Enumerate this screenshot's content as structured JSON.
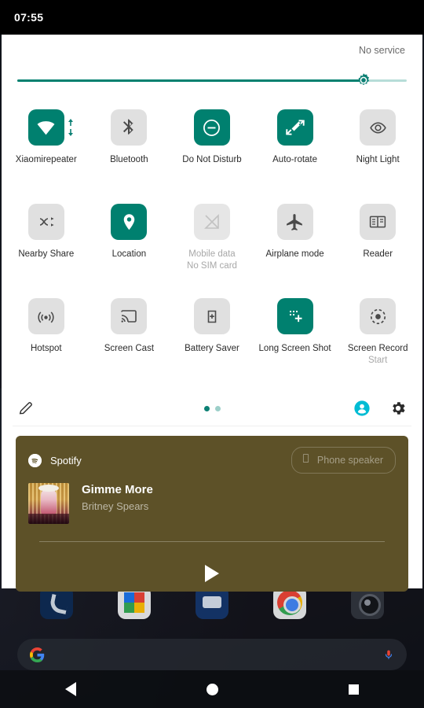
{
  "statusbar": {
    "clock": "07:55"
  },
  "panel": {
    "carrier": "No service",
    "brightness": {
      "value_percent": 89,
      "icon": "brightness-icon"
    }
  },
  "tiles": [
    [
      {
        "label": "Xiaomirepeater",
        "icon": "wifi-icon",
        "state": "on",
        "badge": "data-activity-arrows"
      },
      {
        "label": "Bluetooth",
        "icon": "bluetooth-icon",
        "state": "off"
      },
      {
        "label": "Do Not Disturb",
        "icon": "do-not-disturb-icon",
        "state": "on"
      },
      {
        "label": "Auto-rotate",
        "icon": "auto-rotate-icon",
        "state": "on"
      },
      {
        "label": "Night Light",
        "icon": "night-light-icon",
        "state": "off"
      }
    ],
    [
      {
        "label": "Nearby Share",
        "icon": "nearby-share-icon",
        "state": "off"
      },
      {
        "label": "Location",
        "icon": "location-pin-icon",
        "state": "on"
      },
      {
        "label": "Mobile data",
        "sub": "No SIM card",
        "icon": "mobile-data-off-icon",
        "state": "disabled"
      },
      {
        "label": "Airplane mode",
        "icon": "airplane-icon",
        "state": "off"
      },
      {
        "label": "Reader",
        "icon": "reader-icon",
        "state": "off"
      }
    ],
    [
      {
        "label": "Hotspot",
        "icon": "hotspot-icon",
        "state": "off"
      },
      {
        "label": "Screen Cast",
        "icon": "screen-cast-icon",
        "state": "off"
      },
      {
        "label": "Battery Saver",
        "icon": "battery-saver-icon",
        "state": "off"
      },
      {
        "label": "Long Screen Shot",
        "icon": "long-screenshot-icon",
        "state": "on"
      },
      {
        "label": "Screen Record",
        "sub": "Start",
        "icon": "screen-record-icon",
        "state": "off"
      }
    ]
  ],
  "footer": {
    "edit_icon": "pencil-icon",
    "pages": {
      "count": 2,
      "active_index": 0
    },
    "user_icon": "user-avatar-icon",
    "settings_icon": "gear-icon"
  },
  "notification": {
    "app_name": "Spotify",
    "app_icon": "spotify-icon",
    "output_device": "Phone speaker",
    "output_device_icon": "phone-speaker-icon",
    "track_title": "Gimme More",
    "track_artist": "Britney Spears",
    "album_art": "britney-spears-blackout-album-art",
    "play_button": "play-icon"
  },
  "home": {
    "dock_apps": [
      {
        "name": "phone-app-icon"
      },
      {
        "name": "calendar-app-icon"
      },
      {
        "name": "messages-app-icon"
      },
      {
        "name": "chrome-app-icon"
      },
      {
        "name": "camera-app-icon"
      }
    ],
    "search": {
      "logo": "google-g-icon",
      "mic": "microphone-icon"
    },
    "navbar": [
      {
        "name": "back-button"
      },
      {
        "name": "home-button"
      },
      {
        "name": "recents-button"
      }
    ]
  },
  "colors": {
    "accent_teal": "#00806f",
    "tile_off": "#e0e0e0",
    "notification_bg": "#5d5128",
    "avatar_cyan": "#00bcd4"
  }
}
